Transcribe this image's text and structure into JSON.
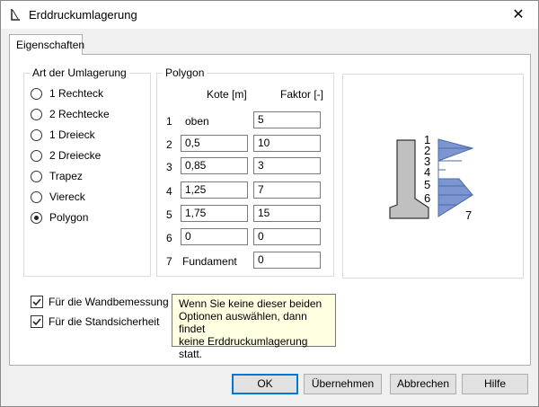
{
  "window": {
    "title": "Erddruckumlagerung"
  },
  "tabs": [
    {
      "label": "Eigenschaften"
    }
  ],
  "umlagerung": {
    "legend": "Art der Umlagerung",
    "options": [
      {
        "label": "1 Rechteck",
        "selected": false
      },
      {
        "label": "2 Rechtecke",
        "selected": false
      },
      {
        "label": "1 Dreieck",
        "selected": false
      },
      {
        "label": "2 Dreiecke",
        "selected": false
      },
      {
        "label": "Trapez",
        "selected": false
      },
      {
        "label": "Viereck",
        "selected": false
      },
      {
        "label": "Polygon",
        "selected": true
      }
    ]
  },
  "polygon": {
    "legend": "Polygon",
    "col_kote": "Kote [m]",
    "col_faktor": "Faktor [-]",
    "rows": [
      {
        "num": "1",
        "kote_label": "oben",
        "faktor": "5"
      },
      {
        "num": "2",
        "kote": "0,5",
        "faktor": "10"
      },
      {
        "num": "3",
        "kote": "0,85",
        "faktor": "3"
      },
      {
        "num": "4",
        "kote": "1,25",
        "faktor": "7"
      },
      {
        "num": "5",
        "kote": "1,75",
        "faktor": "15"
      },
      {
        "num": "6",
        "kote": "0",
        "faktor": "0"
      },
      {
        "num": "7",
        "kote_label": "Fundament",
        "faktor": "0"
      }
    ]
  },
  "preview": {
    "labels": [
      "1",
      "2",
      "3",
      "4",
      "5",
      "6",
      "7"
    ],
    "colors": {
      "pressure_fill": "#7d96d2",
      "pressure_stroke": "#4a6aa8",
      "wall_fill": "#c0c0c0",
      "wall_stroke": "#333333"
    }
  },
  "options": {
    "wandbemessung": {
      "label": "Für die Wandbemessung",
      "checked": true
    },
    "standsicherheit": {
      "label": "Für die Standsicherheit",
      "checked": true
    }
  },
  "tooltip": {
    "line1": "Wenn Sie keine dieser beiden",
    "line2": "Optionen auswählen, dann findet",
    "line3": "keine Erddruckumlagerung statt."
  },
  "buttons": {
    "ok": "OK",
    "apply": "Übernehmen",
    "cancel": "Abbrechen",
    "help": "Hilfe"
  }
}
